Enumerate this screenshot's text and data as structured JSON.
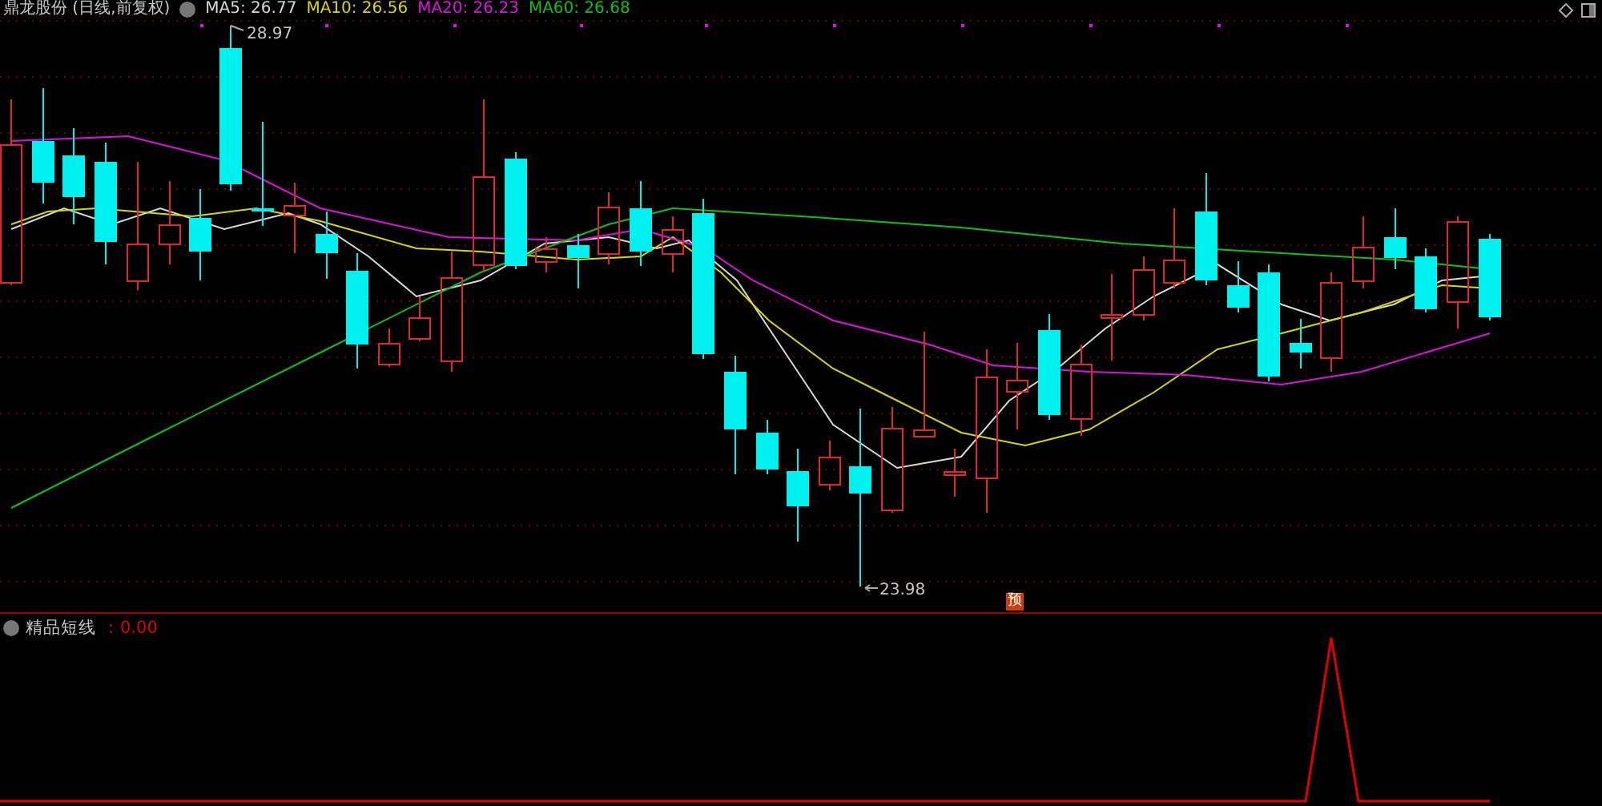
{
  "header": {
    "title": "鼎龙股份 (日线,前复权)",
    "moving_averages": [
      {
        "label": "MA5: 26.77",
        "color": "#d8d8d8"
      },
      {
        "label": "MA10: 26.56",
        "color": "#d8d800"
      },
      {
        "label": "MA20: 26.23",
        "color": "#e010e0"
      },
      {
        "label": "MA60: 26.68",
        "color": "#10c010"
      }
    ]
  },
  "price_chart": {
    "high_label": "28.97",
    "low_label": "23.98",
    "forecast_marker": "预"
  },
  "indicator_panel": {
    "name": "精品短线",
    "value": "：0.00"
  }
}
